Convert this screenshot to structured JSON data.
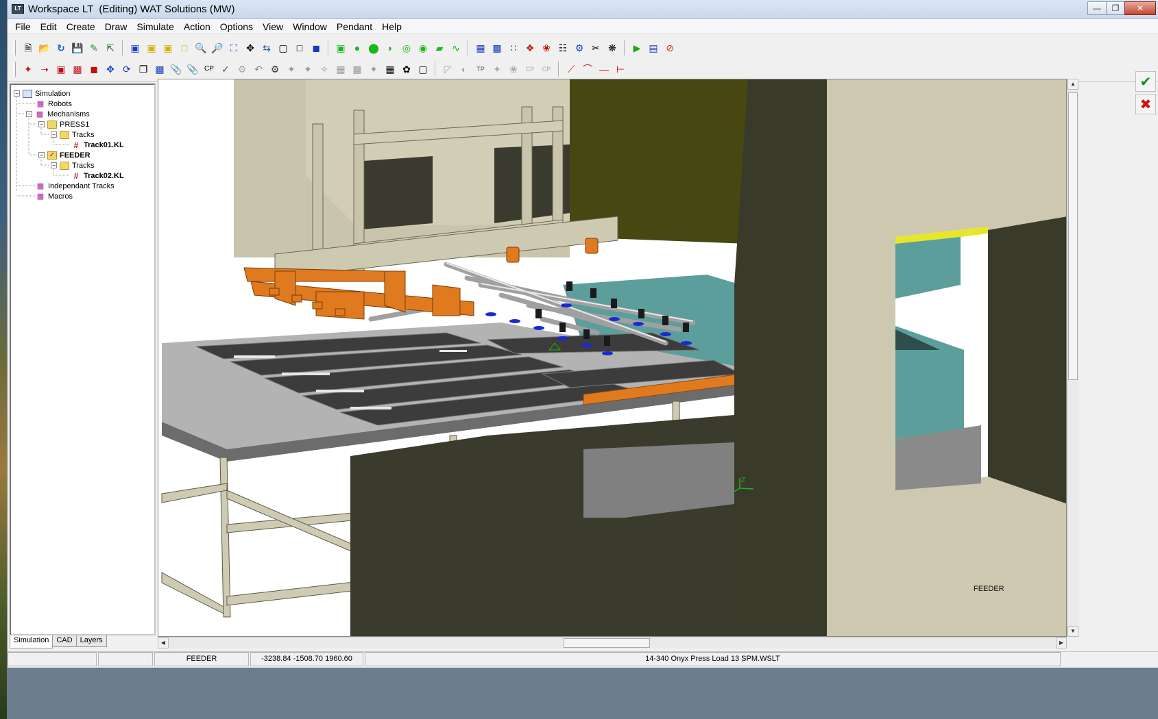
{
  "window": {
    "title": "Workspace LT  (Editing) WAT Solutions (MW)",
    "app_icon_text": "LT"
  },
  "menu": [
    "File",
    "Edit",
    "Create",
    "Draw",
    "Simulate",
    "Action",
    "Options",
    "View",
    "Window",
    "Pendant",
    "Help"
  ],
  "tree": {
    "simulation": "Simulation",
    "robots": "Robots",
    "mechanisms": "Mechanisms",
    "press1": "PRESS1",
    "tracks1": "Tracks",
    "track01": "Track01.KL",
    "feeder": "FEEDER",
    "tracks2": "Tracks",
    "track02": "Track02.KL",
    "independant_tracks": "Independant Tracks",
    "macros": "Macros"
  },
  "tabs": [
    "Simulation",
    "CAD",
    "Layers"
  ],
  "viewport": {
    "feeder_label": "FEEDER",
    "axis_z": "Z"
  },
  "status": {
    "cell1": "",
    "mechanism": "FEEDER",
    "coords": "-3238.84  -1508.70   1960.60",
    "file": "14-340 Onyx Press Load 13 SPM.WSLT"
  },
  "colors": {
    "press_body": "#cdc8b0",
    "dark_wall": "#3a3a2c",
    "feeder_orange": "#e0781e",
    "teal_die": "#5fa5a0",
    "conveyor_gray": "#b4b4b4",
    "olive": "#4a4a10"
  }
}
